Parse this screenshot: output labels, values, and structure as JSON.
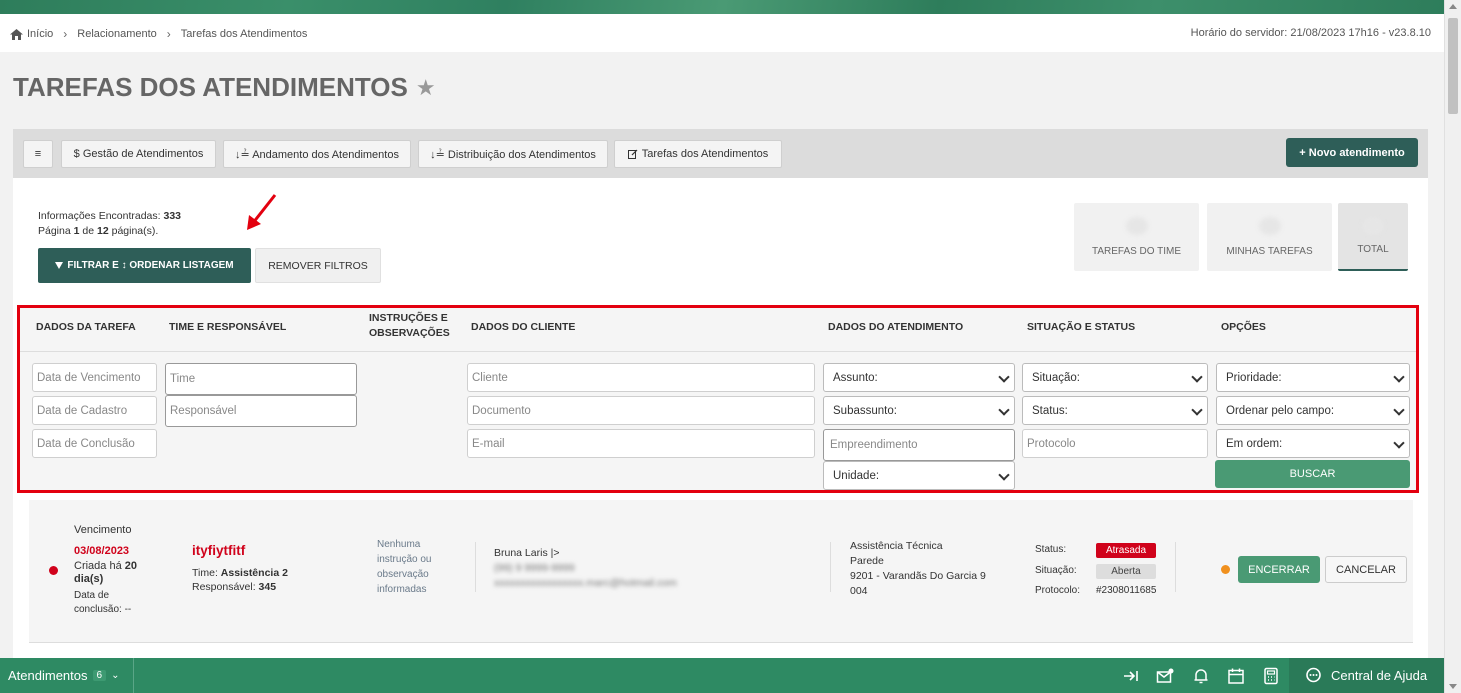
{
  "breadcrumbs": [
    "Início",
    "Relacionamento",
    "Tarefas dos Atendimentos"
  ],
  "server_time": "Horário do servidor: 21/08/2023 17h16 - v23.8.10",
  "page_title": "TAREFAS DOS ATENDIMENTOS",
  "toolbar": {
    "menu_label": "≡",
    "buttons": [
      "$ Gestão de Atendimentos",
      "↓≟ Andamento dos Atendimentos",
      "↓≟ Distribuição dos Atendimentos",
      "Tarefas dos Atendimentos"
    ],
    "new_label": "+ Novo atendimento"
  },
  "info": {
    "found_label": "Informações Encontradas:",
    "found_count": "333",
    "page_prefix": "Página",
    "page_num": "1",
    "page_of": "de",
    "page_total": "12",
    "page_suffix": "página(s)."
  },
  "filter_label": "FILTRAR E ↕ ORDENAR LISTAGEM",
  "remove_label": "REMOVER FILTROS",
  "stats": [
    "TAREFAS DO TIME",
    "MINHAS TAREFAS",
    "TOTAL"
  ],
  "filters": {
    "headers": [
      "DADOS DA TAREFA",
      "TIME E RESPONSÁVEL",
      "INSTRUÇÕES E",
      "OBSERVAÇÕES",
      "DADOS DO CLIENTE",
      "DADOS DO ATENDIMENTO",
      "SITUAÇÃO E STATUS",
      "OPÇÕES"
    ],
    "tarefa": [
      "Data de Vencimento",
      "Data de Cadastro",
      "Data de Conclusão"
    ],
    "time": [
      "Time",
      "Responsável"
    ],
    "cliente": [
      "Cliente",
      "Documento",
      "E-mail"
    ],
    "atendimento": [
      "Assunto:",
      "Subassunto:",
      "Empreendimento",
      "Unidade:"
    ],
    "situacao": [
      "Situação:",
      "Status:",
      "Protocolo"
    ],
    "opcoes": [
      "Prioridade:",
      "Ordenar pelo campo:",
      "Em ordem:"
    ],
    "buscar_label": "BUSCAR"
  },
  "task": {
    "vencimento_label": "Vencimento",
    "vencimento_date": "03/08/2023",
    "criada_line1_pre": "Criada há ",
    "criada_days": "20",
    "criada_line2": "dia(s)",
    "conclusao_line1": "Data de",
    "conclusao_line2": "conclusão: --",
    "title": "ityfiytfitf",
    "time_label": "Time:",
    "time_value": "Assistência 2",
    "resp_label": "Responsável:",
    "resp_value": "345",
    "instrucoes": [
      "Nenhuma",
      "instrução ou",
      "observação",
      "informadas"
    ],
    "client_name": "Bruna Laris |>",
    "client_phone": "(99) 9 9999-9999",
    "client_email": "xxxxxxxxxxxxxxxxx.marc@hotmail.com",
    "atend": [
      "Assistência Técnica",
      "Parede",
      "9201 - Varandãs Do Garcia 9",
      "004"
    ],
    "status_label": "Status:",
    "status_value": "Atrasada",
    "situacao_label": "Situação:",
    "situacao_value": "Aberta",
    "protocolo_label": "Protocolo:",
    "protocolo_value": "#2308011685",
    "encerrar_label": "ENCERRAR",
    "cancelar_label": "CANCELAR"
  },
  "bottom": {
    "atend_label": "Atendimentos",
    "atend_count": "6",
    "help_label": "Central de Ajuda"
  },
  "colors": {
    "primary": "#2e5e58",
    "accent": "#4a9a74",
    "alert": "#e3000f",
    "link_red": "#d0021b",
    "bottom_bar": "#2e8a63"
  }
}
